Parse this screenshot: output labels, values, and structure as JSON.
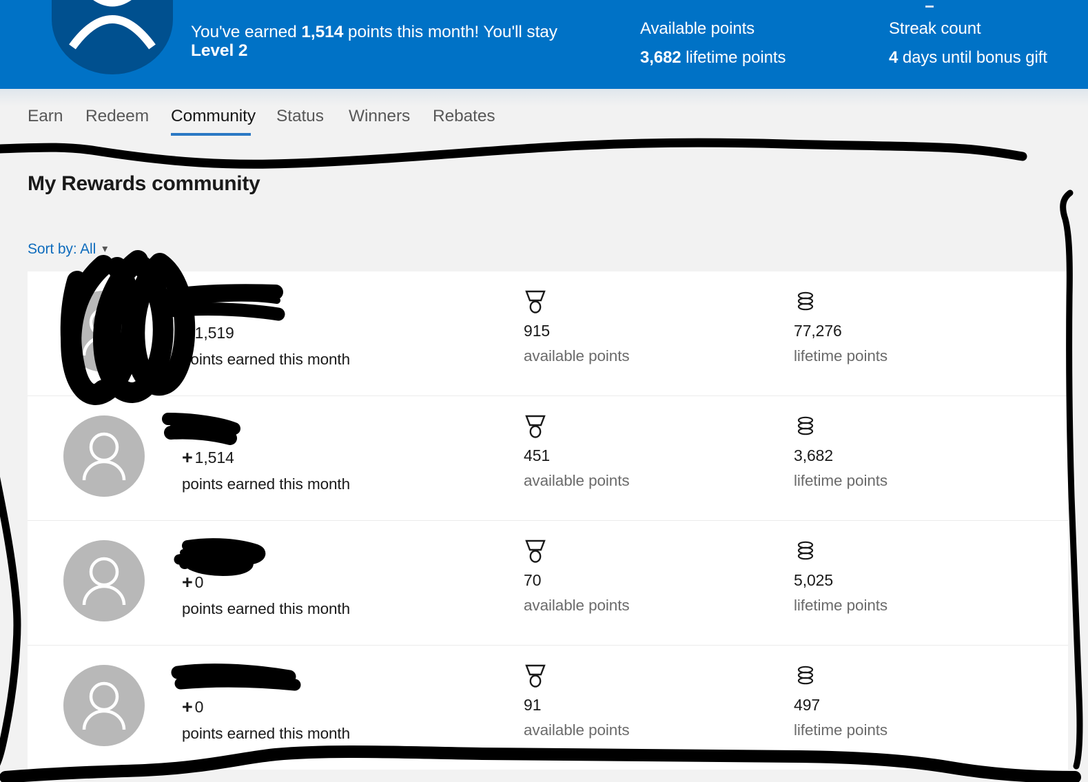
{
  "header": {
    "badge_icon": "rewards-shield-badge",
    "message_prefix": "You've earned ",
    "message_points": "1,514",
    "message_middle": " points this month! You'll stay",
    "message_level": "Level 2",
    "available": {
      "label": "Available points",
      "value": "3,682",
      "suffix": " lifetime points"
    },
    "streak": {
      "label": "Streak count",
      "value": "4",
      "suffix": " days until bonus gift"
    },
    "background_color": "#0072c6",
    "badge_color": "#00508f"
  },
  "nav": {
    "tabs": [
      {
        "label": "Earn",
        "active": false
      },
      {
        "label": "Redeem",
        "active": false
      },
      {
        "label": "Community",
        "active": true
      },
      {
        "label": "Status",
        "active": false
      },
      {
        "label": "Winners",
        "active": false
      },
      {
        "label": "Rebates",
        "active": false
      }
    ],
    "active_underline_color": "#2b79c4"
  },
  "page": {
    "title": "My Rewards community",
    "sort_by_label": "Sort by: All",
    "sort_by_chevron": "chevron-down-icon",
    "link_color": "#0f6cbd"
  },
  "list": {
    "column_icons": {
      "available": "medal-icon",
      "lifetime": "coins-stack-icon"
    },
    "earned_sub_label": "points earned this month",
    "available_label": "available points",
    "lifetime_label": "lifetime points",
    "rows": [
      {
        "name": "",
        "name_redacted": true,
        "avatar_redacted": true,
        "earned": "1,519",
        "available": "915",
        "lifetime": "77,276"
      },
      {
        "name": "",
        "name_redacted": true,
        "avatar_redacted": false,
        "earned": "1,514",
        "available": "451",
        "lifetime": "3,682"
      },
      {
        "name": "",
        "name_redacted": true,
        "avatar_redacted": false,
        "earned": "0",
        "available": "70",
        "lifetime": "5,025"
      },
      {
        "name": "",
        "name_redacted": true,
        "avatar_redacted": false,
        "earned": "0",
        "available": "91",
        "lifetime": "497"
      }
    ]
  },
  "annotations": {
    "ink_color": "#000000",
    "marks": [
      "top-horizontal-line",
      "right-vertical-line",
      "left-vertical-line",
      "bottom-horizontal-line",
      "row1-avatar-scribble",
      "row1-name-scribble",
      "row2-name-scribble",
      "row3-name-scribble",
      "row4-name-scribble"
    ]
  }
}
